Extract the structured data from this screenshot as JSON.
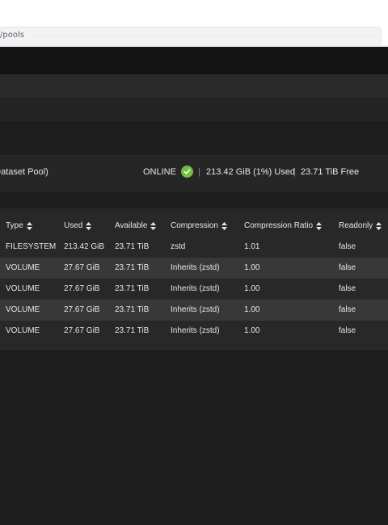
{
  "browser": {
    "url_fragment": "/pools"
  },
  "pool": {
    "name_fragment": "n Dataset Pool)",
    "status": "ONLINE",
    "status_color": "#71bf44",
    "used": "213.42 GiB (1%) Used",
    "free": "23.71 TiB Free",
    "separator": "|"
  },
  "table": {
    "columns": [
      "Type",
      "Used",
      "Available",
      "Compression",
      "Compression Ratio",
      "Readonly"
    ],
    "rows": [
      {
        "type": "FILESYSTEM",
        "used": "213.42 GiB",
        "available": "23.71 TiB",
        "compression": "zstd",
        "ratio": "1.01",
        "readonly": "false"
      },
      {
        "type": "VOLUME",
        "used": "27.67 GiB",
        "available": "23.71 TiB",
        "compression": "Inherits (zstd)",
        "ratio": "1.00",
        "readonly": "false"
      },
      {
        "type": "VOLUME",
        "used": "27.67 GiB",
        "available": "23.71 TiB",
        "compression": "Inherits (zstd)",
        "ratio": "1.00",
        "readonly": "false"
      },
      {
        "type": "VOLUME",
        "used": "27.67 GiB",
        "available": "23.71 TiB",
        "compression": "Inherits (zstd)",
        "ratio": "1.00",
        "readonly": "false"
      },
      {
        "type": "VOLUME",
        "used": "27.67 GiB",
        "available": "23.71 TiB",
        "compression": "Inherits (zstd)",
        "ratio": "1.00",
        "readonly": "false"
      }
    ]
  },
  "icons": {
    "status": "check-circle-icon",
    "sort": "sort-icon"
  }
}
